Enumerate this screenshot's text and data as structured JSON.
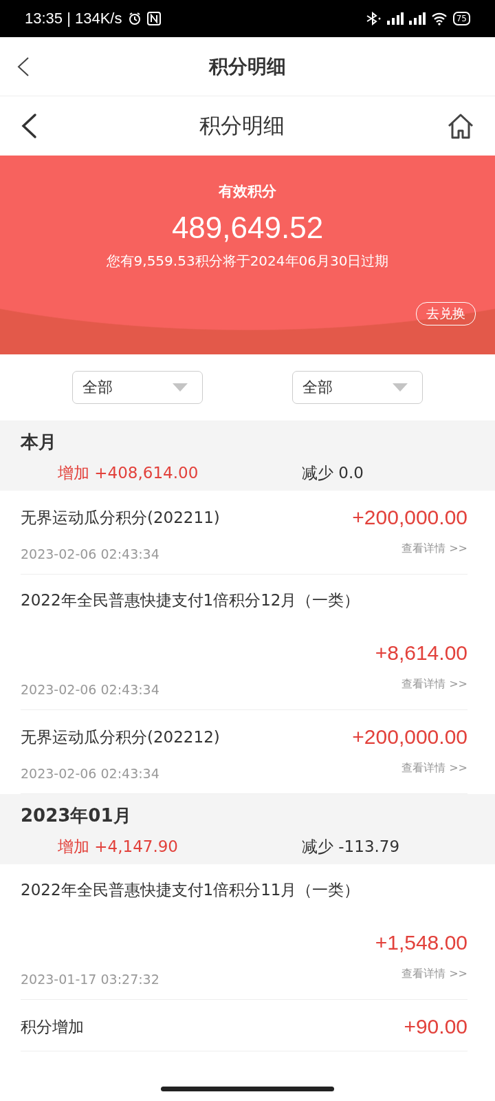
{
  "status_bar": {
    "time_speed": "13:35 | 134K/s",
    "battery": "75"
  },
  "app_header": {
    "title": "积分明细"
  },
  "page_header": {
    "title": "积分明细"
  },
  "banner": {
    "label": "有效积分",
    "points": "489,649.52",
    "expiry_notice": "您有9,559.53积分将于2024年06月30日过期",
    "redeem_button": "去兑换"
  },
  "filters": [
    {
      "value": "全部"
    },
    {
      "value": "全部"
    }
  ],
  "sections": [
    {
      "title": "本月",
      "increase": "增加 +408,614.00",
      "decrease": "减少 0.0",
      "items": [
        {
          "kind": "inline",
          "title": "无界运动瓜分积分(202211)",
          "amount": "+200,000.00",
          "date": "2023-02-06 02:43:34",
          "detail_link": "查看详情 >>"
        },
        {
          "kind": "stacked",
          "title": "2022年全民普惠快捷支付1倍积分12月（一类）",
          "amount": "+8,614.00",
          "date": "2023-02-06 02:43:34",
          "detail_link": "查看详情 >>"
        },
        {
          "kind": "inline",
          "title": "无界运动瓜分积分(202212)",
          "amount": "+200,000.00",
          "date": "2023-02-06 02:43:34",
          "detail_link": "查看详情 >>"
        }
      ]
    },
    {
      "title": "2023年01月",
      "increase": "增加 +4,147.90",
      "decrease": "减少 -113.79",
      "items": [
        {
          "kind": "stacked",
          "title": "2022年全民普惠快捷支付1倍积分11月（一类）",
          "amount": "+1,548.00",
          "date": "2023-01-17 03:27:32",
          "detail_link": "查看详情 >>"
        },
        {
          "kind": "inline",
          "title": "积分增加",
          "amount": "+90.00"
        }
      ]
    }
  ]
}
